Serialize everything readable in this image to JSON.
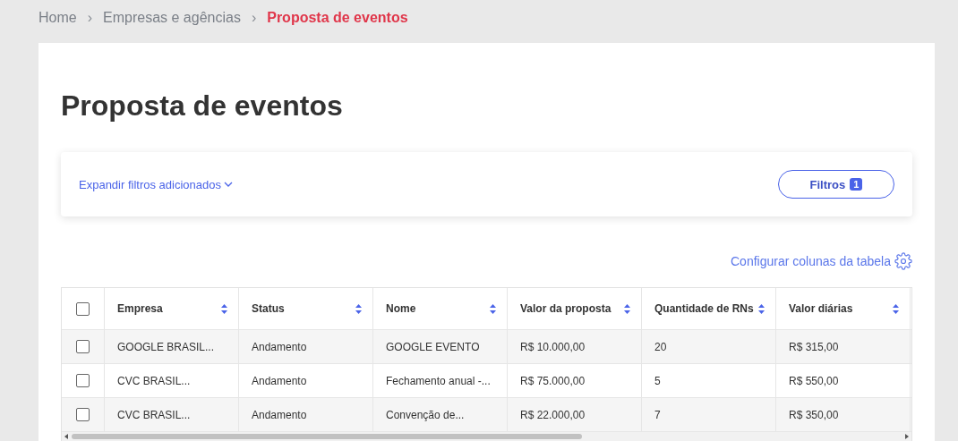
{
  "breadcrumb": [
    {
      "label": "Home",
      "current": false
    },
    {
      "label": "Empresas e agências",
      "current": false
    },
    {
      "label": "Proposta de eventos",
      "current": true
    }
  ],
  "separator": "›",
  "title": "Proposta de eventos",
  "filters": {
    "expand_link": "Expandir filtros adicionados",
    "button": "Filtros",
    "count": "1"
  },
  "configure_link": "Configurar colunas da tabela",
  "table": {
    "select_all": {
      "checked": false
    },
    "columns": [
      "Empresa",
      "Status",
      "Nome",
      "Valor da proposta",
      "Quantidade de RNs",
      "Valor diárias"
    ],
    "rows": [
      {
        "checked": false,
        "cells": [
          "GOOGLE BRASIL...",
          "Andamento",
          "GOOGLE EVENTO",
          "R$ 10.000,00",
          "20",
          "R$ 315,00"
        ]
      },
      {
        "checked": false,
        "cells": [
          "CVC BRASIL...",
          "Andamento",
          "Fechamento anual -...",
          "R$ 75.000,00",
          "5",
          "R$ 550,00"
        ]
      },
      {
        "checked": false,
        "cells": [
          "CVC BRASIL...",
          "Andamento",
          "Convenção de...",
          "R$ 22.000,00",
          "7",
          "R$ 350,00"
        ]
      }
    ]
  }
}
